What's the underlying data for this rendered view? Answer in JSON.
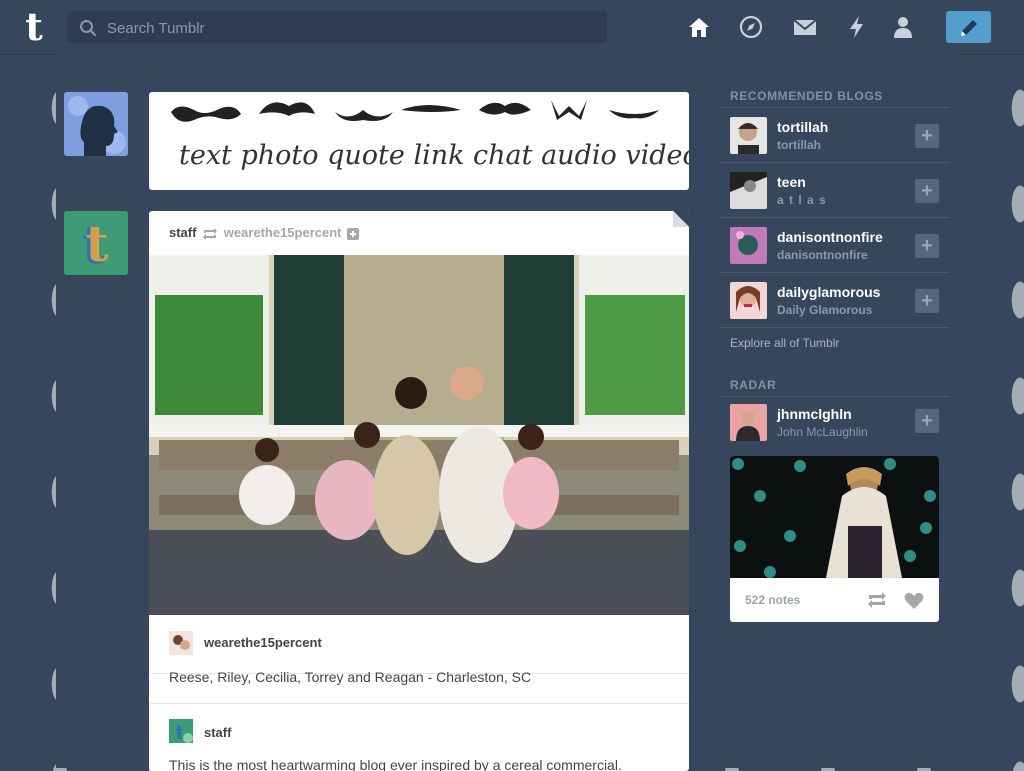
{
  "topbar": {
    "search_placeholder": "Search Tumblr",
    "nav": [
      "home-icon",
      "explore-compass-icon",
      "inbox-mail-icon",
      "activity-lightning-icon",
      "account-person-icon"
    ],
    "compose": "pencil-icon"
  },
  "colors": {
    "background": "#36465d",
    "accent": "#529ecc",
    "muted": "#8a99ae"
  },
  "post_types": {
    "text": "text photo quote link chat audio video"
  },
  "post": {
    "author": "staff",
    "reblogged_from": "wearethe15percent",
    "source_blog": "wearethe15percent",
    "caption": "Reese, Riley, Cecilia, Torrey and Reagan - Charleston, SC",
    "reblogger": "staff",
    "reblog_text": "This is the most heartwarming blog ever inspired by a cereal commercial."
  },
  "sidebar": {
    "recommended_title": "RECOMMENDED BLOGS",
    "recommended": [
      {
        "name": "tortillah",
        "sub": "tortillah"
      },
      {
        "name": "teen",
        "sub": "a t l a s"
      },
      {
        "name": "danisontnonfire",
        "sub": "danisontnonfire"
      },
      {
        "name": "dailyglamorous",
        "sub": "Daily Glamorous"
      }
    ],
    "explore_label": "Explore all of Tumblr",
    "radar_title": "RADAR",
    "radar": {
      "name": "jhnmclghln",
      "sub": "John McLaughlin",
      "notes": "522 notes"
    }
  }
}
